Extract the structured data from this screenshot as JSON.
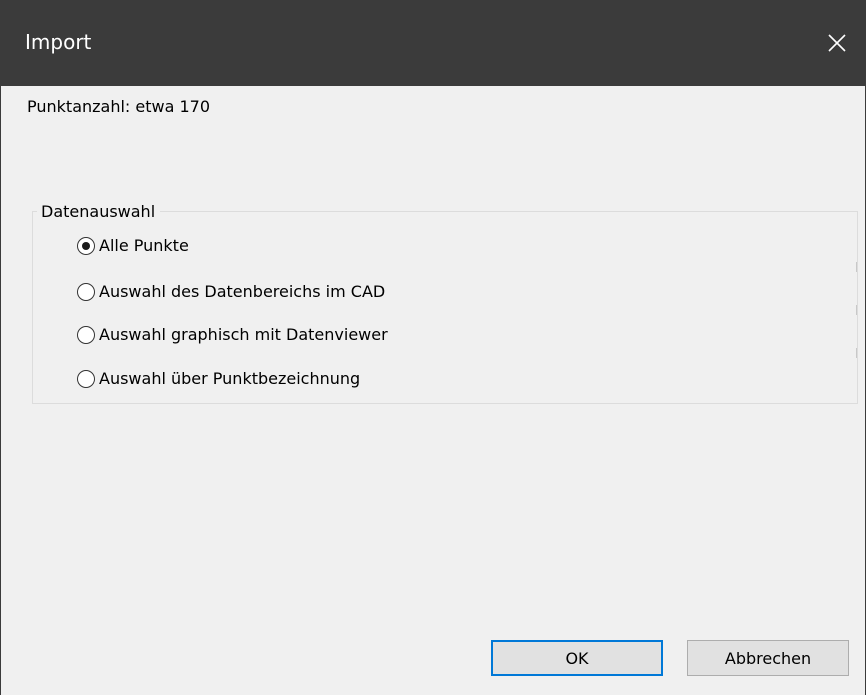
{
  "window": {
    "title": "Import",
    "close_icon": "close-icon"
  },
  "info": {
    "point_count": "Punktanzahl: etwa 170"
  },
  "data_selection": {
    "legend": "Datenauswahl",
    "selected_index": 0,
    "options": [
      "Alle Punkte",
      "Auswahl des Datenbereichs im CAD",
      "Auswahl graphisch mit Datenviewer",
      "Auswahl über Punktbezeichnung"
    ]
  },
  "buttons": {
    "ok_label": "OK",
    "cancel_label": "Abbrechen"
  },
  "colors": {
    "titlebar": "#3b3b3b",
    "dialog_bg": "#f0f0f0",
    "default_button_border": "#0078d7"
  }
}
